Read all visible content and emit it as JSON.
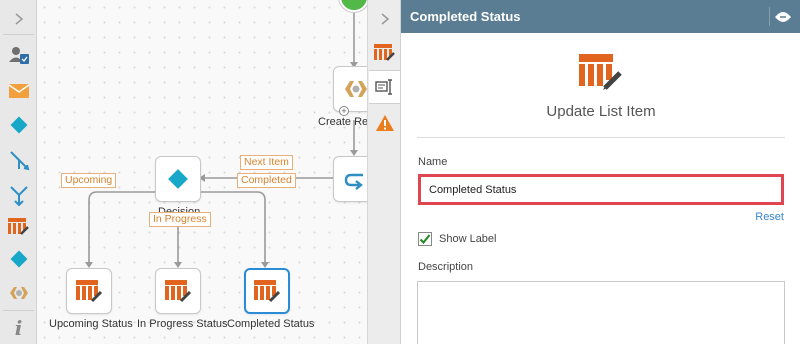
{
  "panel": {
    "title": "Completed Status",
    "action_title": "Update List Item",
    "name_label": "Name",
    "name_value": "Completed Status",
    "reset_label": "Reset",
    "show_label_text": "Show Label",
    "show_label_checked": true,
    "description_label": "Description",
    "description_value": ""
  },
  "canvas": {
    "nodes": {
      "create_label": "Create Ref",
      "decision_label": "Decision",
      "upcoming_label": "Upcoming Status",
      "in_progress_label": "In Progress Status",
      "completed_label": "Completed Status"
    },
    "tags": {
      "next_item": "Next Item",
      "completed": "Completed",
      "upcoming": "Upcoming",
      "in_progress": "In Progress"
    }
  },
  "toolbox": {
    "items": [
      "user-task-icon",
      "email-icon",
      "decision-icon",
      "split-icon",
      "merge-icon",
      "update-list-item-icon",
      "decision-icon",
      "create-item-icon",
      "info-icon"
    ]
  },
  "colors": {
    "header_bg": "#5a7d93",
    "accent_orange": "#e1641f",
    "decision_cyan": "#17a8c9",
    "selected_border": "#2a8bd6",
    "error_border": "#e0464f",
    "tag_orange": "#d9822b"
  }
}
